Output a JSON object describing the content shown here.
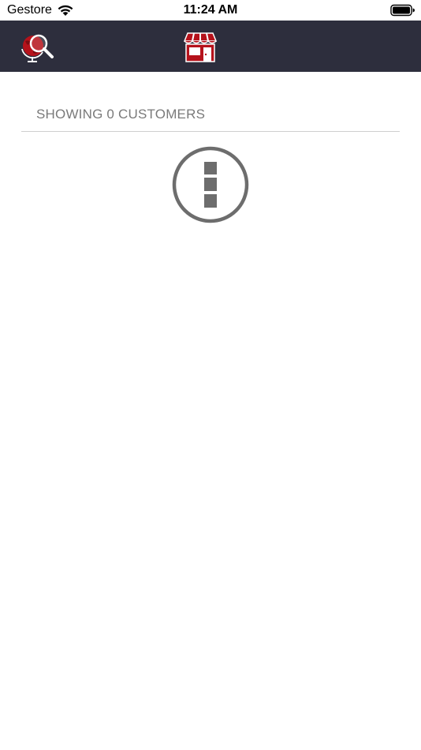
{
  "status_bar": {
    "carrier": "Gestore",
    "time": "11:24 AM"
  },
  "nav_bar": {
    "background": "#2d2e3d",
    "left_icon": "globe-search-icon",
    "center_icon": "store-icon",
    "accent": "#b5121b"
  },
  "main": {
    "count_label": "SHOWING 0 CUSTOMERS",
    "empty_state_icon": "alert-icon"
  }
}
